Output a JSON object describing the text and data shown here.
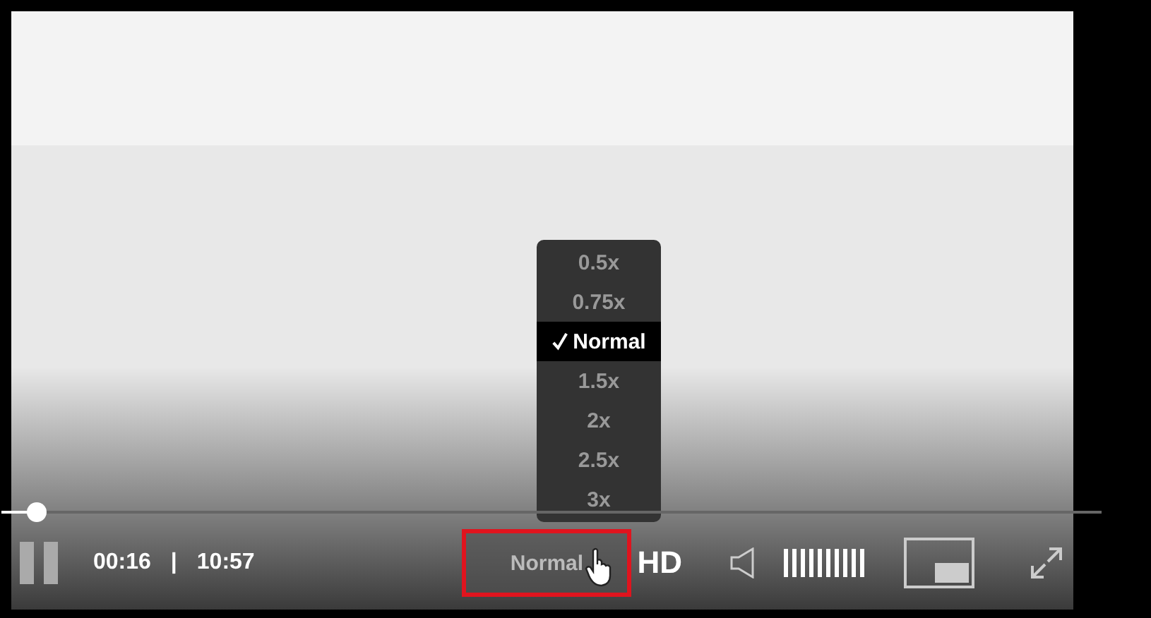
{
  "player": {
    "playing": true,
    "progress": {
      "level": 0.024
    },
    "current_time": "00:16",
    "separator": "|",
    "duration": "10:57",
    "speed_button": {
      "label": "Normal",
      "highlighted": true
    },
    "hd_button": {
      "label": "HD"
    },
    "volume": {
      "level": 1
    },
    "speed_menu": {
      "open": true,
      "options": [
        {
          "label": "0.5x",
          "selected": false
        },
        {
          "label": "0.75x",
          "selected": false
        },
        {
          "label": "Normal",
          "selected": true
        },
        {
          "label": "1.5x",
          "selected": false
        },
        {
          "label": "2x",
          "selected": false
        },
        {
          "label": "2.5x",
          "selected": false
        },
        {
          "label": "3x",
          "selected": false
        }
      ]
    }
  }
}
